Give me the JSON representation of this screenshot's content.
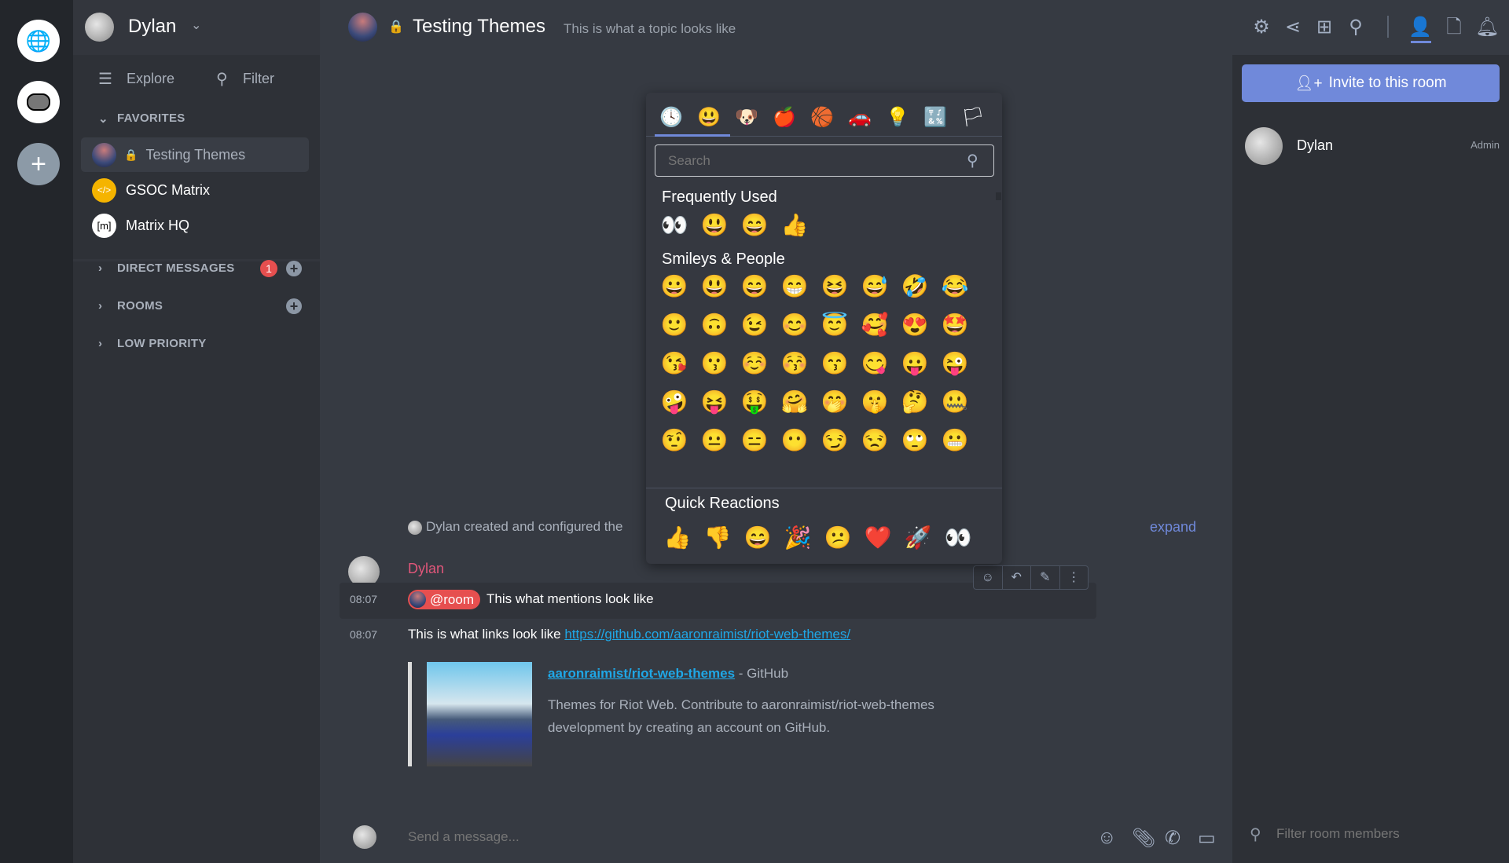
{
  "user": {
    "name": "Dylan"
  },
  "roomlist": {
    "explore": "Explore",
    "filter": "Filter",
    "favorites_label": "FAVORITES",
    "favorites": [
      {
        "name": "Testing Themes",
        "locked": true,
        "selected": true
      },
      {
        "name": "GSOC Matrix"
      },
      {
        "name": "Matrix HQ"
      }
    ],
    "dm_label": "DIRECT MESSAGES",
    "dm_badge": "1",
    "rooms_label": "ROOMS",
    "low_label": "LOW PRIORITY"
  },
  "header": {
    "title": "Testing Themes",
    "topic": "This is what a topic looks like",
    "icons": [
      "settings-icon",
      "share-icon",
      "apps-icon",
      "search-icon",
      "members-icon",
      "files-icon",
      "notifications-icon"
    ]
  },
  "picker": {
    "categories": [
      "🕓",
      "😃",
      "🐶",
      "🍎",
      "🏀",
      "🚗",
      "💡",
      "🔣",
      "🏳"
    ],
    "search_placeholder": "Search",
    "frequent_label": "Frequently Used",
    "frequent": [
      "👀",
      "😃",
      "😄",
      "👍"
    ],
    "smileys_label": "Smileys & People",
    "smileys": [
      "😀",
      "😃",
      "😄",
      "😁",
      "😆",
      "😅",
      "🤣",
      "😂",
      "🙂",
      "🙃",
      "😉",
      "😊",
      "😇",
      "🥰",
      "😍",
      "🤩",
      "😘",
      "😗",
      "☺️",
      "😚",
      "😙",
      "😋",
      "😛",
      "😜",
      "🤪",
      "😝",
      "🤑",
      "🤗",
      "🤭",
      "🤫",
      "🤔",
      "🤐",
      "🤨",
      "😐",
      "😑",
      "😶",
      "😏",
      "😒",
      "🙄",
      "😬"
    ],
    "quick_label": "Quick Reactions",
    "quick": [
      "👍",
      "👎",
      "😄",
      "🎉",
      "😕",
      "❤️",
      "🚀",
      "👀"
    ]
  },
  "timeline": {
    "created": "Dylan created and configured the",
    "expand": "expand",
    "sender": "Dylan",
    "sender_color": "#e0567a",
    "messages": [
      {
        "time": "08:07",
        "mention": "@room",
        "text": "This what mentions look like"
      },
      {
        "time": "08:07",
        "text": "This is what links look like ",
        "link": "https://github.com/aaronraimist/riot-web-themes/"
      }
    ],
    "preview": {
      "title": "aaronraimist/riot-web-themes",
      "site": " - GitHub",
      "desc1": "Themes for Riot Web. Contribute to aaronraimist/riot-web-themes",
      "desc2": "development by creating an account on GitHub."
    }
  },
  "composer": {
    "placeholder": "Send a message..."
  },
  "right": {
    "invite": "Invite to this room",
    "members": [
      {
        "name": "Dylan",
        "role": "Admin"
      }
    ],
    "filter_placeholder": "Filter room members"
  },
  "colors": {
    "accent": "#7089da",
    "mention": "#e64f4f",
    "link": "#1fa7e6"
  }
}
